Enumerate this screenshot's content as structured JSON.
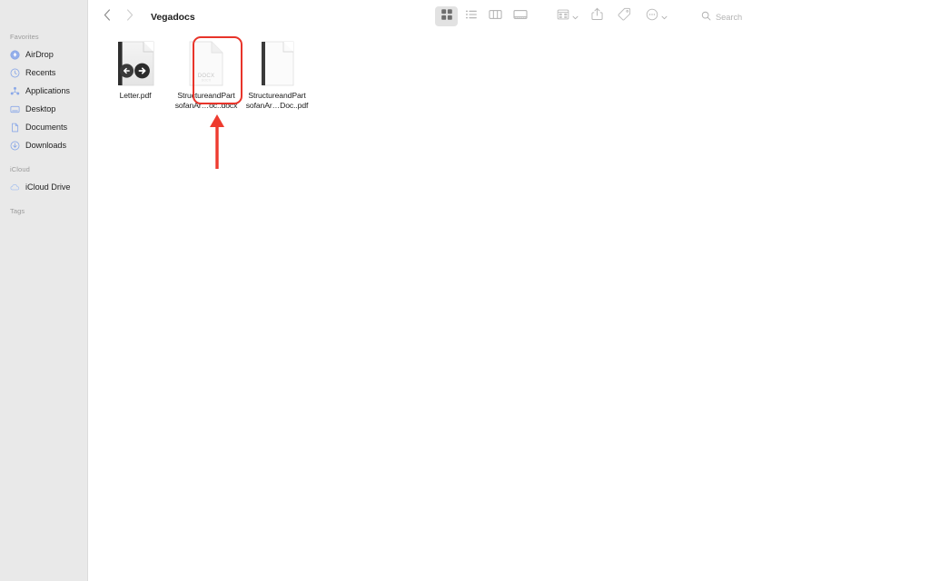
{
  "window": {
    "title": "Vegadocs"
  },
  "sidebar": {
    "sections": [
      {
        "title": "Favorites",
        "items": [
          {
            "label": "AirDrop",
            "icon": "airdrop-icon"
          },
          {
            "label": "Recents",
            "icon": "clock-icon"
          },
          {
            "label": "Applications",
            "icon": "applications-icon"
          },
          {
            "label": "Desktop",
            "icon": "desktop-icon"
          },
          {
            "label": "Documents",
            "icon": "document-icon"
          },
          {
            "label": "Downloads",
            "icon": "download-icon"
          }
        ]
      },
      {
        "title": "iCloud",
        "items": [
          {
            "label": "iCloud Drive",
            "icon": "cloud-icon"
          }
        ]
      },
      {
        "title": "Tags",
        "items": []
      }
    ]
  },
  "toolbar": {
    "back_icon": "chevron-left-icon",
    "forward_icon": "chevron-right-icon",
    "view_modes": [
      {
        "name": "icon-view",
        "icon": "grid-icon",
        "selected": true
      },
      {
        "name": "list-view",
        "icon": "list-icon",
        "selected": false
      },
      {
        "name": "column-view",
        "icon": "columns-icon",
        "selected": false
      },
      {
        "name": "gallery-view",
        "icon": "gallery-icon",
        "selected": false
      }
    ],
    "actions": [
      {
        "name": "group-by-button",
        "icon": "group-grid-icon",
        "chevron": true
      },
      {
        "name": "share-button",
        "icon": "share-icon",
        "chevron": false
      },
      {
        "name": "tag-button",
        "icon": "tag-icon",
        "chevron": false
      },
      {
        "name": "more-button",
        "icon": "more-circle-icon",
        "chevron": true
      }
    ]
  },
  "search": {
    "icon": "search-icon",
    "placeholder": "Search",
    "value": ""
  },
  "files": [
    {
      "name": "Letter.pdf",
      "kind": "pdf",
      "thumbnail": "pdf-preview-with-nav-arrows",
      "selected": true
    },
    {
      "name_line1": "StructureandPart",
      "name_line2": "sofanAr…oc..docx",
      "name": "StructureandPartsofanAr…oc..docx",
      "kind": "docx",
      "thumbnail": "docx-document-icon",
      "badge": "DOCX",
      "selected": false
    },
    {
      "name_line1": "StructureandPart",
      "name_line2": "sofanAr…Doc..pdf",
      "name": "StructureandPartsofanAr…Doc..pdf",
      "kind": "pdf",
      "thumbnail": "pdf-page-preview",
      "selected": false
    }
  ],
  "annotations": {
    "highlight_color": "#e8342a",
    "arrow_color": "#ee3b2f",
    "target": "Letter.pdf"
  },
  "colors": {
    "sidebar_bg": "#e9e9e9",
    "content_bg": "#ffffff",
    "accent_blue": "#8aa8e8",
    "text": "#242424",
    "muted_text": "#9b9b9b"
  }
}
